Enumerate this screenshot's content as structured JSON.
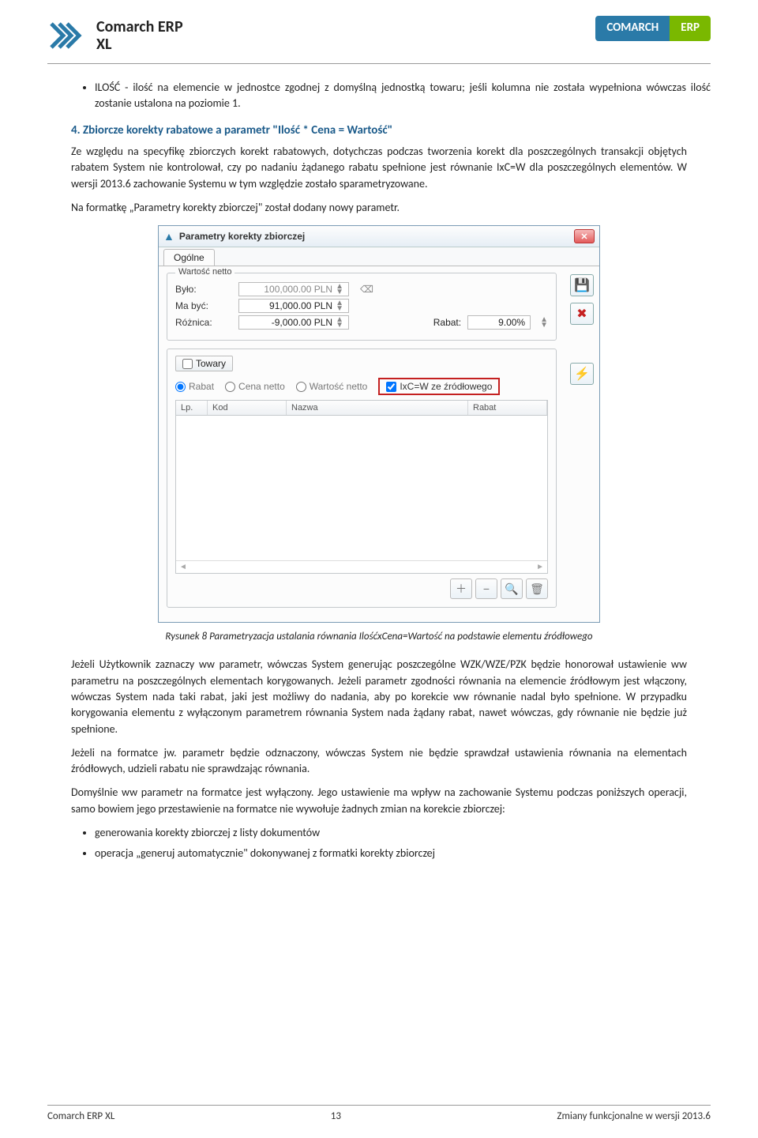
{
  "header": {
    "brand_line1": "Comarch ERP",
    "brand_line2": "XL",
    "badge_left": "COMARCH",
    "badge_right": "ERP"
  },
  "top_bullet": "ILOŚĆ - ilość na elemencie w jednostce zgodnej z domyślną jednostką towaru; jeśli kolumna nie została wypełniona wówczas ilość zostanie ustalona na poziomie 1.",
  "section_title": "4. Zbiorcze korekty rabatowe a parametr \"Ilość * Cena = Wartość\"",
  "para1": "Ze względu na specyfikę zbiorczych korekt rabatowych, dotychczas podczas tworzenia korekt dla poszczególnych transakcji objętych rabatem System nie kontrolował, czy po nadaniu żądanego rabatu spełnione jest równanie IxC=W dla poszczególnych elementów. W wersji 2013.6 zachowanie Systemu w tym względzie zostało sparametryzowane.",
  "para2": "Na formatkę „Parametry korekty zbiorczej\" został dodany nowy parametr.",
  "dialog": {
    "title": "Parametry korekty zbiorczej",
    "tab": "Ogólne",
    "group_netto": "Wartość netto",
    "bylo_label": "Było:",
    "bylo_value": "100,000.00 PLN",
    "mabyc_label": "Ma być:",
    "mabyc_value": "91,000.00 PLN",
    "roznica_label": "Różnica:",
    "roznica_value": "-9,000.00 PLN",
    "rabat_label": "Rabat:",
    "rabat_value": "9.00%",
    "towary_label": "Towary",
    "radio_rabat": "Rabat",
    "radio_cena": "Cena netto",
    "radio_wartosc": "Wartość netto",
    "checkbox_ixc": "IxC=W ze źródłowego",
    "th_lp": "Lp.",
    "th_kod": "Kod",
    "th_nazwa": "Nazwa",
    "th_rabat": "Rabat"
  },
  "caption": "Rysunek 8 Parametryzacja ustalania równania IlośćxCena=Wartość na podstawie elementu źródłowego",
  "para3": "Jeżeli Użytkownik zaznaczy ww parametr, wówczas System generując poszczególne WZK/WZE/PZK będzie honorował ustawienie ww parametru na poszczególnych elementach korygowanych. Jeżeli parametr zgodności równania na elemencie źródłowym jest włączony, wówczas System nada taki rabat, jaki jest możliwy do nadania, aby po korekcie ww równanie nadal było spełnione. W przypadku korygowania elementu z wyłączonym parametrem równania System nada żądany rabat, nawet wówczas, gdy równanie nie będzie już spełnione.",
  "para4": "Jeżeli na formatce jw. parametr będzie odznaczony, wówczas System nie będzie sprawdzał ustawienia równania na elementach źródłowych, udzieli rabatu nie sprawdzając równania.",
  "para5": "Domyślnie ww parametr na formatce jest wyłączony. Jego ustawienie ma wpływ na zachowanie Systemu podczas poniższych operacji, samo bowiem jego przestawienie na formatce nie wywołuje żadnych zmian na korekcie zbiorczej:",
  "bottom_bullets": [
    "generowania korekty zbiorczej z listy dokumentów",
    "operacja „generuj automatycznie\" dokonywanej z formatki korekty zbiorczej"
  ],
  "footer": {
    "left": "Comarch ERP XL",
    "center": "13",
    "right": "Zmiany funkcjonalne w wersji 2013.6"
  }
}
